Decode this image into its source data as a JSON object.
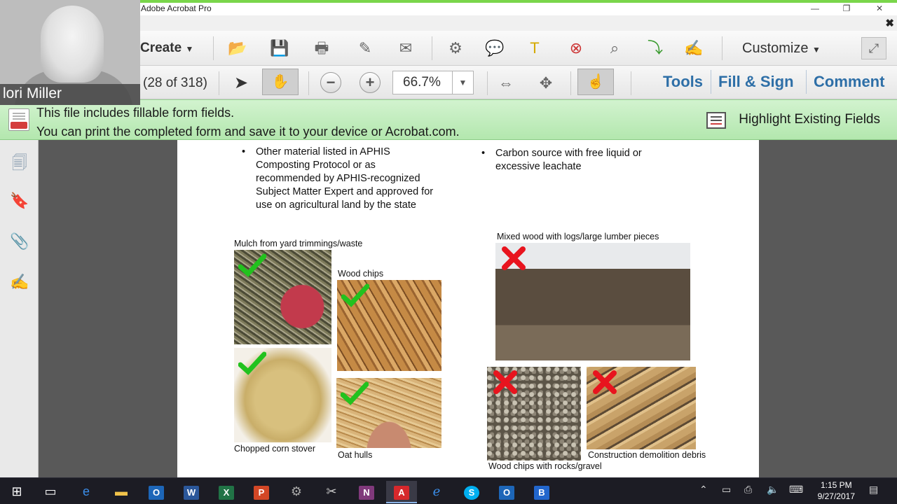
{
  "webcam": {
    "name": "lori Miller"
  },
  "window": {
    "title": "Adobe Acrobat Pro",
    "minimize": "—",
    "restore": "❐",
    "close": "✕",
    "close_doc": "✖"
  },
  "toolbar": {
    "create_label": "Create",
    "customize_label": "Customize",
    "page_count": "(28 of 318)",
    "zoom_value": "66.7%",
    "tools_label": "Tools",
    "fill_sign_label": "Fill & Sign",
    "comment_label": "Comment"
  },
  "banner": {
    "line1": "This file includes fillable form fields.",
    "line2": "You can print the completed form and save it to your device or Acrobat.com.",
    "highlight_button": "Highlight Existing Fields"
  },
  "document": {
    "left_bullets": [
      "Other material listed in APHIS Composting Protocol or as recommended by APHIS-recognized Subject Matter Expert and approved for use on agricultural land by the state"
    ],
    "right_bullets": [
      "Carbon source with free liquid or excessive leachate"
    ],
    "captions": {
      "mulch": "Mulch from yard trimmings/waste",
      "wood_chips": "Wood chips",
      "corn_stover": "Chopped corn stover",
      "oat_hulls": "Oat hulls",
      "mixed_wood": "Mixed wood with logs/large lumber pieces",
      "rocks": "Wood chips with rocks/gravel",
      "demolition": "Construction demolition debris"
    }
  },
  "taskbar": {
    "time": "1:15 PM",
    "date": "9/27/2017"
  },
  "colors": {
    "approved": "#22c21e",
    "rejected": "#e8141e",
    "banner": "#c4eec0",
    "link": "#2e6fa7"
  }
}
